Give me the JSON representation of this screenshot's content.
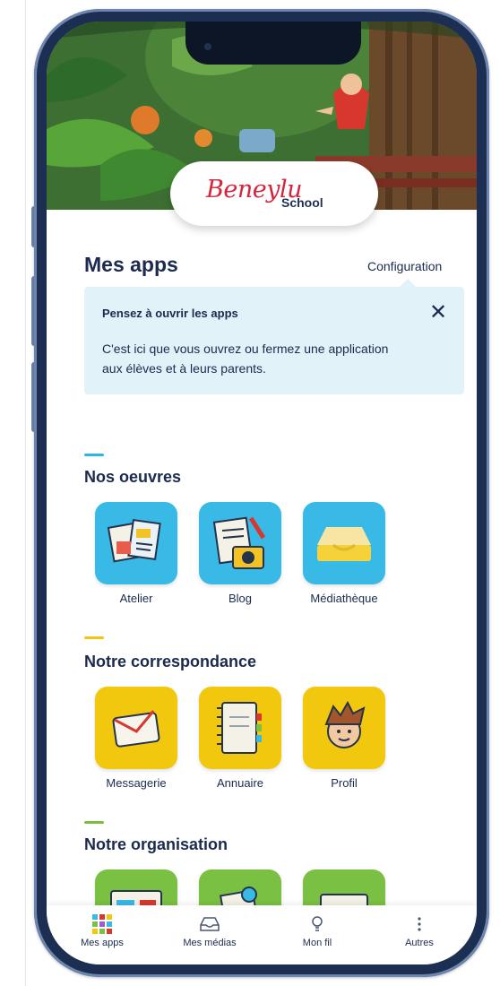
{
  "header": {
    "brand_name": "Beneylu",
    "brand_suffix": "School"
  },
  "page": {
    "title": "Mes apps",
    "config_link": "Configuration"
  },
  "notice": {
    "title": "Pensez à ouvrir les apps",
    "body": "C'est ici que vous ouvrez ou fermez une application aux élèves et à leurs parents.",
    "close_icon": "close-icon"
  },
  "sections": [
    {
      "title": "Nos oeuvres",
      "accent": "#2bb7e1",
      "apps": [
        {
          "label": "Atelier",
          "icon": "atelier-icon",
          "color": "#38b9e6"
        },
        {
          "label": "Blog",
          "icon": "blog-icon",
          "color": "#38b9e6"
        },
        {
          "label": "Médiathèque",
          "icon": "mediatheque-icon",
          "color": "#38b9e6"
        }
      ]
    },
    {
      "title": "Notre correspondance",
      "accent": "#f1c40f",
      "apps": [
        {
          "label": "Messagerie",
          "icon": "messagerie-icon",
          "color": "#f2c80f"
        },
        {
          "label": "Annuaire",
          "icon": "annuaire-icon",
          "color": "#f2c80f"
        },
        {
          "label": "Profil",
          "icon": "profil-icon",
          "color": "#f2c80f"
        }
      ]
    },
    {
      "title": "Notre organisation",
      "accent": "#7dbd3a",
      "apps": [
        {
          "label": "",
          "icon": "agenda-icon",
          "color": "#79c043"
        },
        {
          "label": "",
          "icon": "cahier-icon",
          "color": "#79c043"
        },
        {
          "label": "",
          "icon": "planning-icon",
          "color": "#79c043"
        }
      ]
    }
  ],
  "bottom_nav": [
    {
      "label": "Mes apps",
      "icon": "apps-grid-icon",
      "active": true
    },
    {
      "label": "Mes médias",
      "icon": "inbox-icon",
      "active": false
    },
    {
      "label": "Mon fil",
      "icon": "bulb-icon",
      "active": false
    },
    {
      "label": "Autres",
      "icon": "more-vertical-icon",
      "active": false
    }
  ],
  "colors": {
    "phone_frame": "#1c2e52",
    "text": "#1b2a4e",
    "notice_bg": "#e1f2f9",
    "brand_red": "#d6243e"
  }
}
